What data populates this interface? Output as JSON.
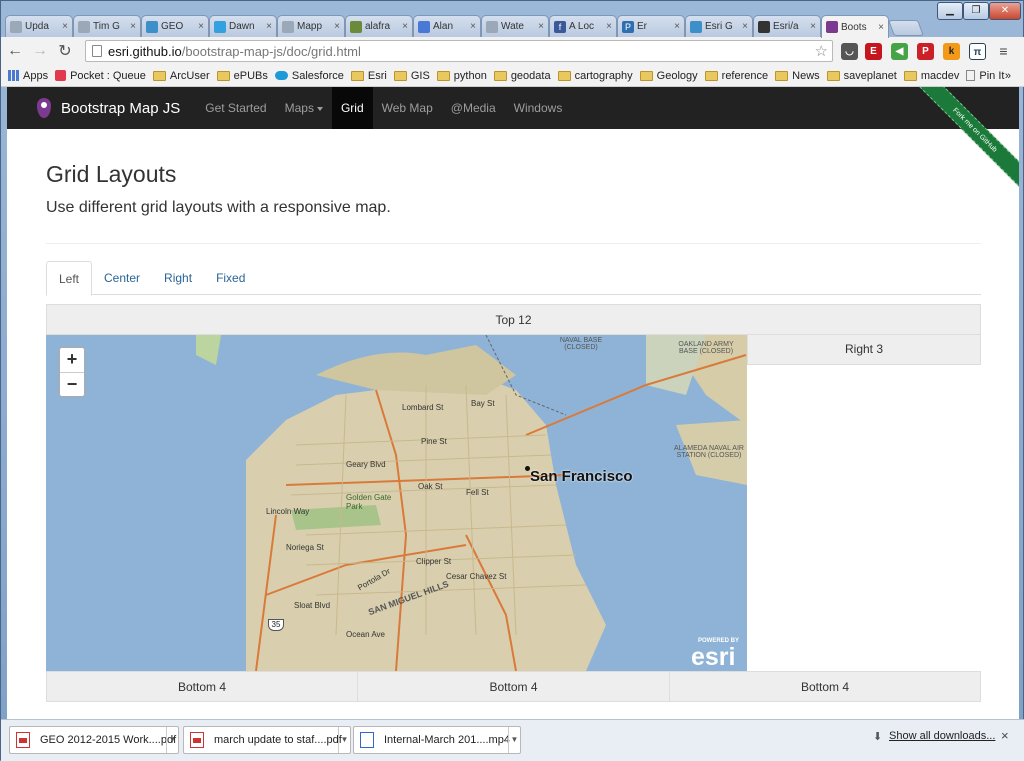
{
  "browser": {
    "tabs": [
      {
        "label": "Upda",
        "icon": "doc-icon",
        "color": "#9aa8b8"
      },
      {
        "label": "Tim G",
        "icon": "doc-icon",
        "color": "#9aa8b8"
      },
      {
        "label": "GEO",
        "icon": "globe-icon",
        "color": "#3c8fc7"
      },
      {
        "label": "Dawn",
        "icon": "twitter-icon",
        "color": "#33a1e0"
      },
      {
        "label": "Mapp",
        "icon": "doc-icon",
        "color": "#9aa8b8"
      },
      {
        "label": "alafra",
        "icon": "map-icon",
        "color": "#6a8c3a"
      },
      {
        "label": "Alan",
        "icon": "google-icon",
        "color": "#4a78d6"
      },
      {
        "label": "Wate",
        "icon": "doc-icon",
        "color": "#9aa8b8"
      },
      {
        "label": "A Loc",
        "icon": "facebook-icon",
        "color": "#3b5998"
      },
      {
        "label": "Er",
        "icon": "pandora-icon",
        "color": "#2f6fb0"
      },
      {
        "label": "Esri G",
        "icon": "globe-icon",
        "color": "#3c8fc7"
      },
      {
        "label": "Esri/a",
        "icon": "github-icon",
        "color": "#333333"
      },
      {
        "label": "Boots",
        "icon": "pin-icon",
        "color": "#7b3a8f"
      }
    ],
    "url_host": "esri.github.io",
    "url_path": "/bootstrap-map-js/doc/grid.html",
    "bookmarks_apps": "Apps",
    "bookmarks": [
      "Pocket : Queue",
      "ArcUser",
      "ePUBs",
      "Salesforce",
      "Esri",
      "GIS",
      "python",
      "geodata",
      "cartography",
      "Geology",
      "reference",
      "News",
      "saveplanet",
      "macdev",
      "Pin It"
    ],
    "bookmarks_more": "»"
  },
  "site": {
    "brand": "Bootstrap Map JS",
    "nav": [
      "Get Started",
      "Maps",
      "Grid",
      "Web Map",
      "@Media",
      "Windows"
    ],
    "ribbon": "Fork me on GitHub",
    "title": "Grid Layouts",
    "lead": "Use different grid layouts with a responsive map.",
    "tabs": [
      "Left",
      "Center",
      "Right",
      "Fixed"
    ],
    "top": "Top 12",
    "right": "Right 3",
    "bottom": [
      "Bottom 4",
      "Bottom 4",
      "Bottom 4"
    ]
  },
  "map": {
    "zoom_in": "+",
    "zoom_out": "−",
    "city": "San Francisco",
    "labels": [
      "OAKLAND ARMY BASE (CLOSED)",
      "NAVAL BASE (CLOSED)",
      "ALAMEDA NAVAL AIR STATION (CLOSED)",
      "Geary Blvd",
      "Lincoln Way",
      "Noriega St",
      "Sloat Blvd",
      "SAN MIGUEL HILLS",
      "Golden Gate Park",
      "Lombard St",
      "Bay St",
      "Pine St",
      "Oak St",
      "Fell St",
      "Clipper St",
      "Cesar Chavez St",
      "Portola Dr",
      "Ocean Ave",
      "35"
    ],
    "attribution_top": "POWERED BY",
    "attribution": "esri"
  },
  "downloads": {
    "items": [
      "GEO 2012-2015 Work....pdf",
      "march update to staf....pdf",
      "Internal-March 201....mp4"
    ],
    "show_all": "Show all downloads...",
    "close": "×"
  }
}
